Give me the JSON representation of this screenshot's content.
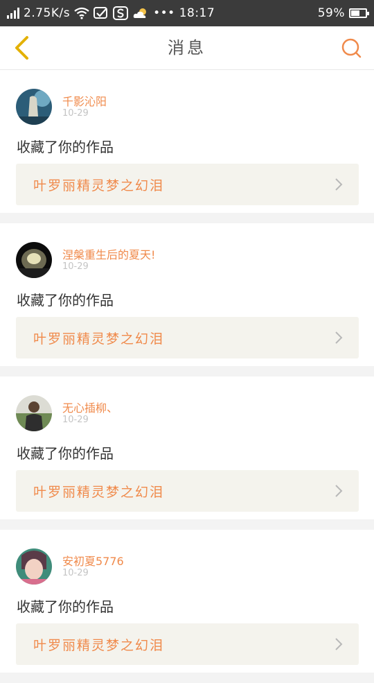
{
  "status_bar": {
    "network_speed": "2.75K/s",
    "dots": "•••",
    "time": "18:17",
    "battery_percent": "59%",
    "battery_level": 0.59
  },
  "header": {
    "title": "消息",
    "back_icon": "chevron-left-icon",
    "search_icon": "search-icon"
  },
  "colors": {
    "accent": "#f08a4b",
    "back_icon": "#e3b100",
    "status_bar": "#3b3b3b"
  },
  "notifications": [
    {
      "username": "千影沁阳",
      "date": "10-29",
      "action": "收藏了你的作品",
      "work_title": "叶罗丽精灵梦之幻泪"
    },
    {
      "username": "涅槃重生后的夏天!",
      "date": "10-29",
      "action": "收藏了你的作品",
      "work_title": "叶罗丽精灵梦之幻泪"
    },
    {
      "username": "无心插柳、",
      "date": "10-29",
      "action": "收藏了你的作品",
      "work_title": "叶罗丽精灵梦之幻泪"
    },
    {
      "username": "安初夏5776",
      "date": "10-29",
      "action": "收藏了你的作品",
      "work_title": "叶罗丽精灵梦之幻泪"
    }
  ]
}
